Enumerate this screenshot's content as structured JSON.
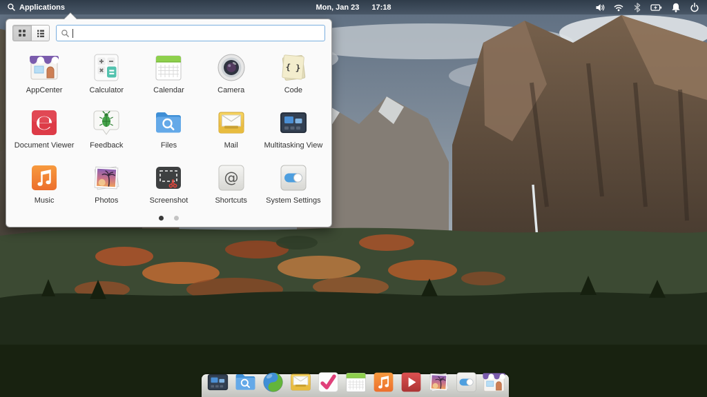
{
  "panel": {
    "applications_label": "Applications",
    "date": "Mon, Jan 23",
    "time": "17:18",
    "indicators": [
      {
        "name": "volume-icon"
      },
      {
        "name": "wifi-icon"
      },
      {
        "name": "bluetooth-icon"
      },
      {
        "name": "battery-charging-icon"
      },
      {
        "name": "notifications-icon"
      },
      {
        "name": "power-icon"
      }
    ]
  },
  "launcher": {
    "search_value": "",
    "search_placeholder": "",
    "active_view": "grid",
    "apps": [
      {
        "label": "AppCenter",
        "icon": "appcenter-icon"
      },
      {
        "label": "Calculator",
        "icon": "calculator-icon"
      },
      {
        "label": "Calendar",
        "icon": "calendar-icon"
      },
      {
        "label": "Camera",
        "icon": "camera-icon"
      },
      {
        "label": "Code",
        "icon": "code-icon"
      },
      {
        "label": "Document Viewer",
        "icon": "document-viewer-icon"
      },
      {
        "label": "Feedback",
        "icon": "feedback-icon"
      },
      {
        "label": "Files",
        "icon": "files-icon"
      },
      {
        "label": "Mail",
        "icon": "mail-icon"
      },
      {
        "label": "Multitasking View",
        "icon": "multitasking-view-icon"
      },
      {
        "label": "Music",
        "icon": "music-icon"
      },
      {
        "label": "Photos",
        "icon": "photos-icon"
      },
      {
        "label": "Screenshot",
        "icon": "screenshot-icon"
      },
      {
        "label": "Shortcuts",
        "icon": "shortcuts-icon"
      },
      {
        "label": "System Settings",
        "icon": "system-settings-icon"
      }
    ],
    "pages": {
      "count": 2,
      "active_index": 0
    }
  },
  "dock": {
    "items": [
      {
        "name": "multitasking-view"
      },
      {
        "name": "files"
      },
      {
        "name": "web-browser"
      },
      {
        "name": "mail"
      },
      {
        "name": "tasks"
      },
      {
        "name": "calendar"
      },
      {
        "name": "music"
      },
      {
        "name": "videos"
      },
      {
        "name": "photos"
      },
      {
        "name": "system-settings"
      },
      {
        "name": "appcenter"
      }
    ]
  },
  "colors": {
    "accent_blue": "#3689e6",
    "search_border": "#79aede",
    "panel_text": "#ffffff",
    "popup_bg": "#fafafa",
    "active_dot": "#3a3a3a",
    "inactive_dot": "#c4c4c4"
  }
}
